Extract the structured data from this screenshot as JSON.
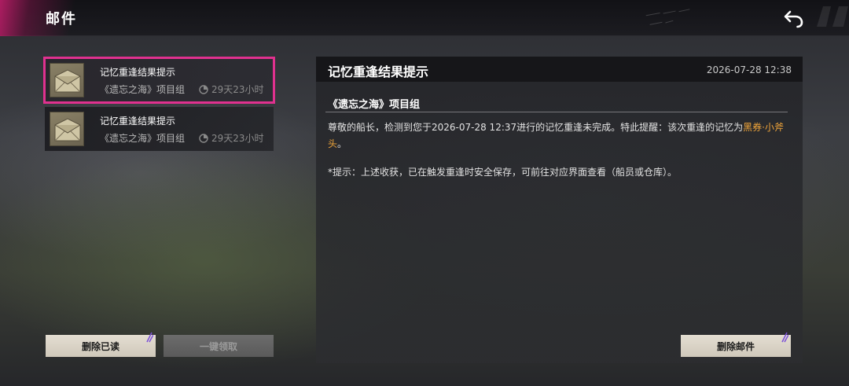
{
  "header": {
    "title": "邮件",
    "back_icon": "back-arrow-icon"
  },
  "mail_list": [
    {
      "subject": "记忆重逢结果提示",
      "sender": "《遗忘之海》项目组",
      "expiry": "29天23小时",
      "selected": true,
      "icon": "envelope-icon"
    },
    {
      "subject": "记忆重逢结果提示",
      "sender": "《遗忘之海》项目组",
      "expiry": "29天23小时",
      "selected": false,
      "icon": "envelope-icon"
    }
  ],
  "detail": {
    "title": "记忆重逢结果提示",
    "date": "2026-07-28 12:38",
    "sender": "《遗忘之海》项目组",
    "body_prefix": "尊敬的船长，检测到您于2026-07-28 12:37进行的记忆重逢未完成。特此提醒：该次重逢的记忆为",
    "body_highlight": "黑券·小斧头",
    "body_suffix": "。",
    "note": "*提示：上述收获，已在触发重逢时安全保存，可前往对应界面查看（船员或仓库）。"
  },
  "buttons": {
    "delete_read": "删除已读",
    "claim_all": "一键领取",
    "delete_mail": "删除邮件"
  },
  "colors": {
    "accent": "#e0318f",
    "highlight": "#f0a53a"
  }
}
